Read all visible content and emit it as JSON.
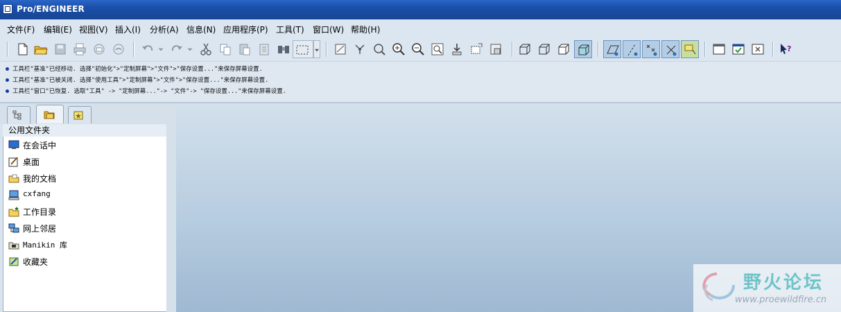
{
  "window": {
    "title": "Pro/ENGINEER"
  },
  "menu": [
    {
      "label": "文件(F)"
    },
    {
      "label": "编辑(E)"
    },
    {
      "label": "视图(V)"
    },
    {
      "label": "插入(I)"
    },
    {
      "label": "分析(A)"
    },
    {
      "label": "信息(N)"
    },
    {
      "label": "应用程序(P)"
    },
    {
      "label": "工具(T)"
    },
    {
      "label": "窗口(W)"
    },
    {
      "label": "帮助(H)"
    }
  ],
  "messages": [
    "工具栏\"基准\"已经移动. 选择\"初始化\">\"定制屏幕\">\"文件\">\"保存设置...\"来保存屏幕设置.",
    "工具栏\"基准\"已被关闭. 选择\"使用工具\">\"定制屏幕\">\"文件\">\"保存设置...\"来保存屏幕设置.",
    "工具栏\"窗口\"已恢复. 选取\"工具\" -> \"定制屏幕...\"-> \"文件\"-> \"保存设置...\"来保存屏幕设置."
  ],
  "navigator": {
    "header": "公用文件夹",
    "folders": [
      {
        "label": "在会话中",
        "icon": "monitor-icon"
      },
      {
        "label": "桌面",
        "icon": "desktop-icon"
      },
      {
        "label": "我的文档",
        "icon": "documents-icon"
      },
      {
        "label": "cxfang",
        "icon": "computer-icon"
      },
      {
        "label": "工作目录",
        "icon": "working-directory-icon"
      },
      {
        "label": "网上邻居",
        "icon": "network-icon"
      },
      {
        "label": "Manikin 库",
        "icon": "library-icon"
      },
      {
        "label": "收藏夹",
        "icon": "favorites-icon"
      }
    ]
  },
  "watermark": {
    "text": "野火论坛",
    "url": "www.proewildfire.cn"
  },
  "colors": {
    "titlebar": "#1a4fa8",
    "toolbar": "#dbe6f1",
    "graphics_top": "#d3e0ec",
    "graphics_bottom": "#9fb9d2"
  }
}
